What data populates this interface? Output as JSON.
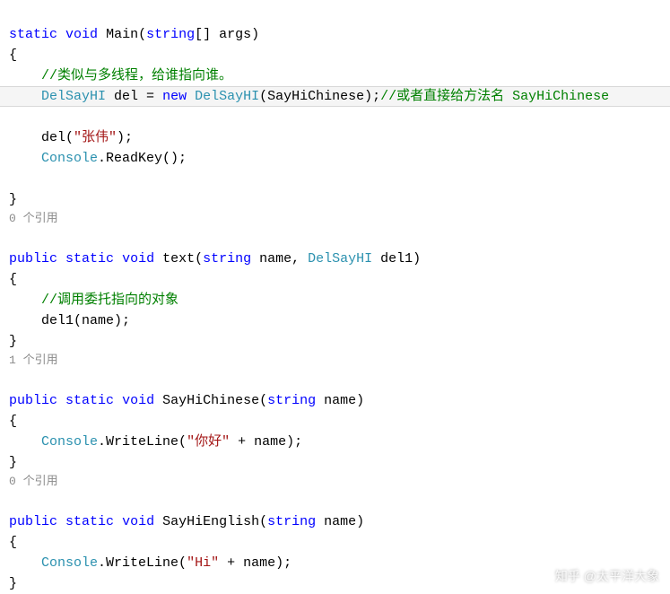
{
  "lines": {
    "main_sig_1": "static",
    "main_sig_2": "void",
    "main_sig_3": "Main(",
    "main_sig_4": "string",
    "main_sig_5": "[] args)",
    "brace_o": "{",
    "cmt1": "//类似与多线程，给谁指向谁。",
    "l4_1": "DelSayHI",
    "l4_2": "del = ",
    "l4_3": "new",
    "l4_4": " ",
    "l4_5": "DelSayHI",
    "l4_6": "(SayHiChinese);",
    "l4_7": "//或者直接给方法名 SayHiChinese",
    "l5_1": "del(",
    "l5_2": "\"张伟\"",
    "l5_3": ");",
    "l6_1": "Console",
    "l6_2": ".ReadKey();",
    "brace_c": "}",
    "ref0": "0 个引用",
    "t_sig_1": "public",
    "t_sig_2": "static",
    "t_sig_3": "void",
    "t_sig_4": "text(",
    "t_sig_5": "string",
    "t_sig_6": " name, ",
    "t_sig_7": "DelSayHI",
    "t_sig_8": " del1)",
    "cmt2": "//调用委托指向的对象",
    "t_body": "del1(name);",
    "ref1": "1 个引用",
    "c_sig_1": "public",
    "c_sig_2": "static",
    "c_sig_3": "void",
    "c_sig_4": "SayHiChinese(",
    "c_sig_5": "string",
    "c_sig_6": " name)",
    "c_body_1": "Console",
    "c_body_2": ".WriteLine(",
    "c_body_3": "\"你好\"",
    "c_body_4": " + name);",
    "ref0b": "0 个引用",
    "e_sig_1": "public",
    "e_sig_2": "static",
    "e_sig_3": "void",
    "e_sig_4": "SayHiEnglish(",
    "e_sig_5": "string",
    "e_sig_6": " name)",
    "e_body_1": "Console",
    "e_body_2": ".WriteLine(",
    "e_body_3": "\"Hi\"",
    "e_body_4": " + name);"
  },
  "watermark": "知乎 @太平洋大象"
}
